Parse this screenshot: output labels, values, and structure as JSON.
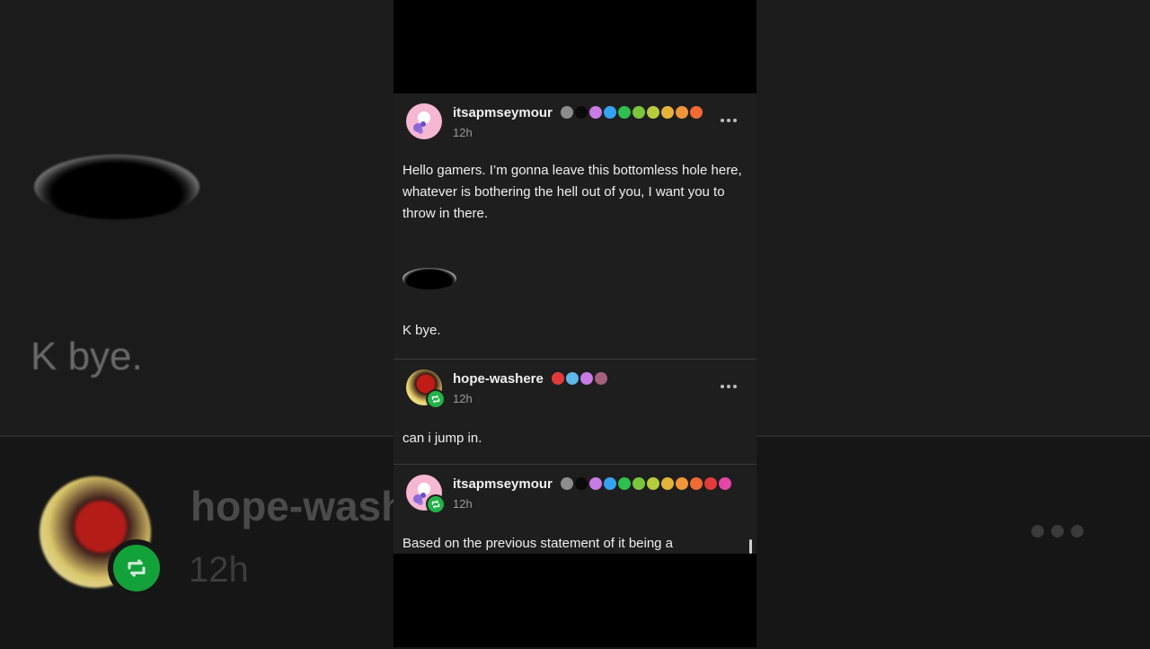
{
  "background": {
    "caption": "K bye.",
    "username": "hope-washere",
    "time": "12h"
  },
  "posts": [
    {
      "username": "itsapmseymour",
      "time": "12h",
      "paragraphs": [
        "Hello gamers. I’m gonna leave this bottomless hole here, whatever is bothering the hell out of you, I want you to throw in there.",
        "K bye."
      ],
      "badge_colors": [
        "#8d8d8d",
        "#0a0a0a",
        "#c77be4",
        "#35a3ef",
        "#2fbf4f",
        "#7cc63d",
        "#b7cc3c",
        "#e4b43a",
        "#f0963a",
        "#f06a34"
      ]
    },
    {
      "username": "hope-washere",
      "time": "12h",
      "paragraphs": [
        "can i jump in."
      ],
      "badge_colors": [
        "#e23a3a",
        "#5fb7e6",
        "#c77be4",
        "#a3627a"
      ]
    },
    {
      "username": "itsapmseymour",
      "time": "12h",
      "paragraphs": [
        "Based on the previous statement of it being a"
      ],
      "badge_colors": [
        "#8d8d8d",
        "#0a0a0a",
        "#c77be4",
        "#35a3ef",
        "#2fbf4f",
        "#7cc63d",
        "#b7cc3c",
        "#e4b43a",
        "#f0963a",
        "#f06a34",
        "#e33b3b",
        "#e546a8"
      ]
    }
  ],
  "icons": {
    "more": "more-horizontal-icon",
    "reblog": "reblog-icon",
    "hole": "hole-image"
  }
}
